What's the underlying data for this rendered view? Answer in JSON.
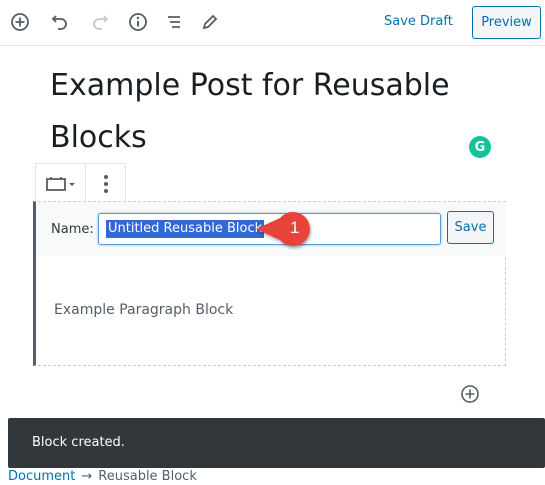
{
  "toolbar": {
    "icons": [
      "add-block-icon",
      "undo-icon",
      "redo-icon",
      "info-icon",
      "outline-icon",
      "edit-icon"
    ],
    "save_draft_label": "Save Draft",
    "preview_label": "Preview"
  },
  "post": {
    "title": "Example Post for Reusable Blocks"
  },
  "block": {
    "name_label": "Name:",
    "name_value": "Untitled Reusable Block",
    "save_label": "Save",
    "paragraph_text": "Example Paragraph Block"
  },
  "annotation": {
    "number": "1",
    "color": "#e8423c"
  },
  "snackbar": {
    "message": "Block created."
  },
  "breadcrumb": {
    "root": "Document",
    "separator": "→",
    "current": "Reusable Block"
  },
  "colors": {
    "accent": "#0073aa",
    "selection": "#3367d6",
    "snackbar_bg": "#32373c",
    "grammarly": "#15c39a"
  }
}
